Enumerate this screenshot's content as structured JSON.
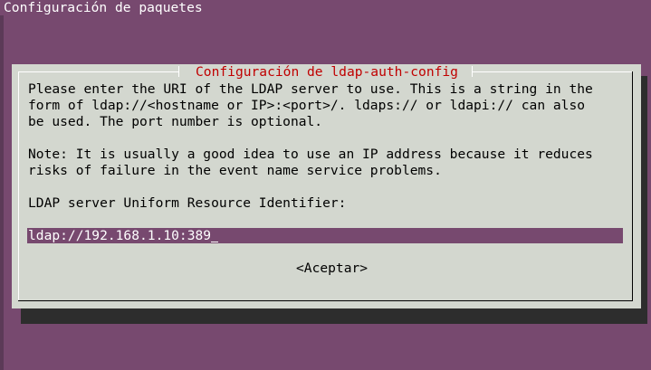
{
  "window": {
    "title": "Configuración de paquetes"
  },
  "dialog": {
    "title": "Configuración de ldap-auth-config",
    "paragraph1": [
      "Please enter the URI of the LDAP server to use. This is a string in the",
      "form of ldap://<hostname or IP>:<port>/. ldaps:// or ldapi:// can also",
      "be used. The port number is optional."
    ],
    "paragraph2": [
      "Note: It is usually a good idea to use an IP address because it reduces",
      "risks of failure in the event name service problems."
    ],
    "field_label": "LDAP server Uniform Resource Identifier:",
    "input_value": "ldap://192.168.1.10:389",
    "accept_label": "<Aceptar>"
  },
  "colors": {
    "terminal_background": "#77496f",
    "dialog_background": "#d3d7cf",
    "dialog_title": "#c00000",
    "input_background": "#77496f",
    "shadow": "#2d2d2d"
  }
}
